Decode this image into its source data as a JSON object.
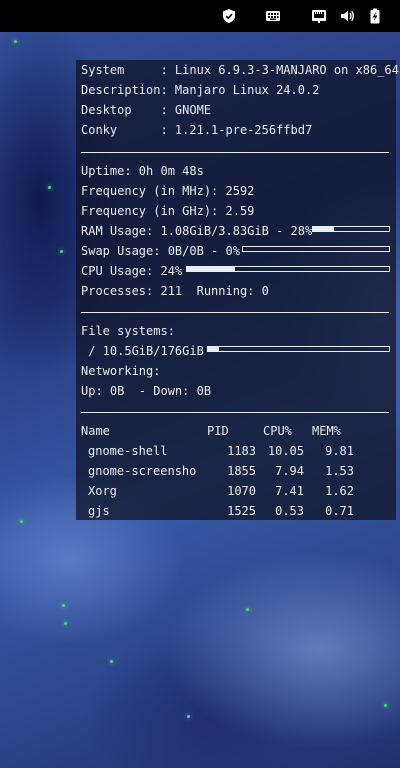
{
  "taskbar": {
    "icons": [
      "shield-icon",
      "keyboard-icon",
      "network-icon",
      "volume-icon",
      "battery-icon"
    ]
  },
  "conky": {
    "system_rows": [
      {
        "label": "System     : ",
        "value": "Linux 6.9.3-3-MANJARO on x86_64"
      },
      {
        "label": "Description: ",
        "value": "Manjaro Linux 24.0.2"
      },
      {
        "label": "Desktop    : ",
        "value": "GNOME"
      },
      {
        "label": "Conky      : ",
        "value": "1.21.1-pre-256ffbd7"
      }
    ],
    "uptime": "Uptime: 0h 0m 48s",
    "freq_mhz": "Frequency (in MHz): 2592",
    "freq_ghz": "Frequency (in GHz): 2.59",
    "ram": {
      "text": "RAM Usage: 1.08GiB/3.83GiB - 28%",
      "percent": 28
    },
    "swap": {
      "text": "Swap Usage: 0B/0B - 0%",
      "percent": 0
    },
    "cpu": {
      "text": "CPU Usage: 24%",
      "percent": 24
    },
    "processes": "Processes: 211  Running: 0",
    "filesystems_label": "File systems:",
    "fs_root": {
      "text": " / 10.5GiB/176GiB",
      "percent": 6
    },
    "networking_label": "Networking:",
    "net": "Up: 0B  - Down: 0B",
    "process_table": {
      "headers": [
        "Name",
        "PID",
        "CPU%",
        "MEM%"
      ],
      "rows": [
        {
          "name": "gnome-shell",
          "pid": "1183",
          "cpu": "10.05",
          "mem": "9.81"
        },
        {
          "name": "gnome-screensho",
          "pid": "1855",
          "cpu": "7.94",
          "mem": "1.53"
        },
        {
          "name": "Xorg",
          "pid": "1070",
          "cpu": "7.41",
          "mem": "1.62"
        },
        {
          "name": "gjs",
          "pid": "1525",
          "cpu": "0.53",
          "mem": "0.71"
        }
      ]
    }
  }
}
